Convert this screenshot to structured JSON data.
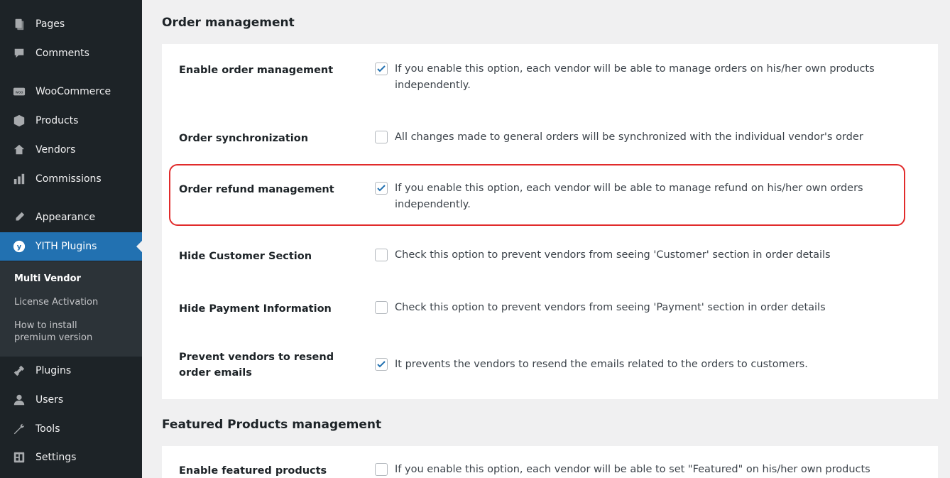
{
  "sidebar": {
    "items": [
      {
        "label": "Pages",
        "icon": "pages-icon"
      },
      {
        "label": "Comments",
        "icon": "comments-icon"
      },
      {
        "label": "WooCommerce",
        "icon": "woocommerce-icon"
      },
      {
        "label": "Products",
        "icon": "products-icon"
      },
      {
        "label": "Vendors",
        "icon": "vendors-icon"
      },
      {
        "label": "Commissions",
        "icon": "commissions-icon"
      },
      {
        "label": "Appearance",
        "icon": "appearance-icon"
      },
      {
        "label": "YITH Plugins",
        "icon": "yith-icon"
      },
      {
        "label": "Plugins",
        "icon": "plugins-icon"
      },
      {
        "label": "Users",
        "icon": "users-icon"
      },
      {
        "label": "Tools",
        "icon": "tools-icon"
      },
      {
        "label": "Settings",
        "icon": "settings-icon"
      }
    ],
    "submenu": {
      "multi_vendor": "Multi Vendor",
      "license_activation": "License Activation",
      "how_to_install_1": "How to install",
      "how_to_install_2": "premium version"
    }
  },
  "order_management": {
    "title": "Order management",
    "rows": [
      {
        "label": "Enable order management",
        "checked": true,
        "desc": "If you enable this option, each vendor will be able to manage orders on his/her own products independently."
      },
      {
        "label": "Order synchronization",
        "checked": false,
        "desc": "All changes made to general orders will be synchronized with the individual vendor's order"
      },
      {
        "label": "Order refund management",
        "checked": true,
        "desc": "If you enable this option, each vendor will be able to manage refund on his/her own orders independently."
      },
      {
        "label": "Hide Customer Section",
        "checked": false,
        "desc": "Check this option to prevent vendors from seeing 'Customer' section in order details"
      },
      {
        "label": "Hide Payment Information",
        "checked": false,
        "desc": "Check this option to prevent vendors from seeing 'Payment' section in order details"
      },
      {
        "label_1": "Prevent vendors to resend",
        "label_2": "order emails",
        "checked": true,
        "desc": "It prevents the vendors to resend the emails related to the orders to customers."
      }
    ]
  },
  "featured_management": {
    "title": "Featured Products management",
    "rows": [
      {
        "label": "Enable featured products",
        "checked": false,
        "desc": "If you enable this option, each vendor will be able to set \"Featured\" on his/her own products"
      }
    ]
  },
  "colors": {
    "sidebar_bg": "#1d2327",
    "active_bg": "#2271b1",
    "highlight_border": "#e12b2b",
    "checkmark": "#2271b1"
  }
}
